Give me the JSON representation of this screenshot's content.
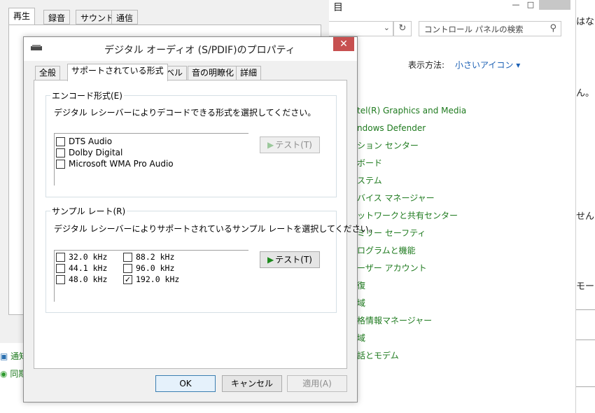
{
  "sound_dialog": {
    "tabs": [
      "再生",
      "録音",
      "サウンド",
      "通信"
    ],
    "bottom_items": [
      "通知",
      "同期"
    ]
  },
  "control_panel": {
    "title_fragment": "目",
    "search_placeholder": "コントロール パネルの検索",
    "view_label": "表示方法:",
    "view_value": "小さいアイコン ▾",
    "items": [
      "tel(R) Graphics and Media",
      "ndows Defender",
      "ション センター",
      "ボード",
      "ステム",
      "バイス マネージャー",
      "ットワークと共有センター",
      "ミリー セーフティ",
      "ログラムと機能",
      "ーザー アカウント",
      "復",
      "域",
      "格情報マネージャー",
      "域",
      "話とモデム"
    ]
  },
  "right_strip": {
    "texts": [
      "はない",
      "ん。",
      "せん",
      "モード"
    ]
  },
  "dialog": {
    "title": "デジタル オーディオ (S/PDIF)のプロパティ",
    "close_label": "✕",
    "tabs": [
      "全般",
      "サポートされている形式",
      "レベル",
      "音の明瞭化",
      "詳細"
    ],
    "encode_group": {
      "legend": "エンコード形式(E)",
      "description": "デジタル レシーバーによりデコードできる形式を選択してください。",
      "formats": [
        {
          "label": "DTS Audio",
          "checked": false
        },
        {
          "label": "Dolby Digital",
          "checked": false
        },
        {
          "label": "Microsoft WMA Pro Audio",
          "checked": false
        }
      ],
      "test_label": "テスト(T)",
      "test_enabled": false
    },
    "sample_group": {
      "legend": "サンプル レート(R)",
      "description": "デジタル レシーバーによりサポートされているサンプル レートを選択してください。",
      "rates_col1": [
        {
          "label": "32.0 kHz",
          "checked": false
        },
        {
          "label": "44.1 kHz",
          "checked": false
        },
        {
          "label": "48.0 kHz",
          "checked": false
        }
      ],
      "rates_col2": [
        {
          "label": "88.2 kHz",
          "checked": false
        },
        {
          "label": "96.0 kHz",
          "checked": false
        },
        {
          "label": "192.0 kHz",
          "checked": true
        }
      ],
      "test_label": "テスト(T)",
      "test_enabled": true
    },
    "buttons": {
      "ok": "OK",
      "cancel": "キャンセル",
      "apply": "適用(A)"
    }
  }
}
